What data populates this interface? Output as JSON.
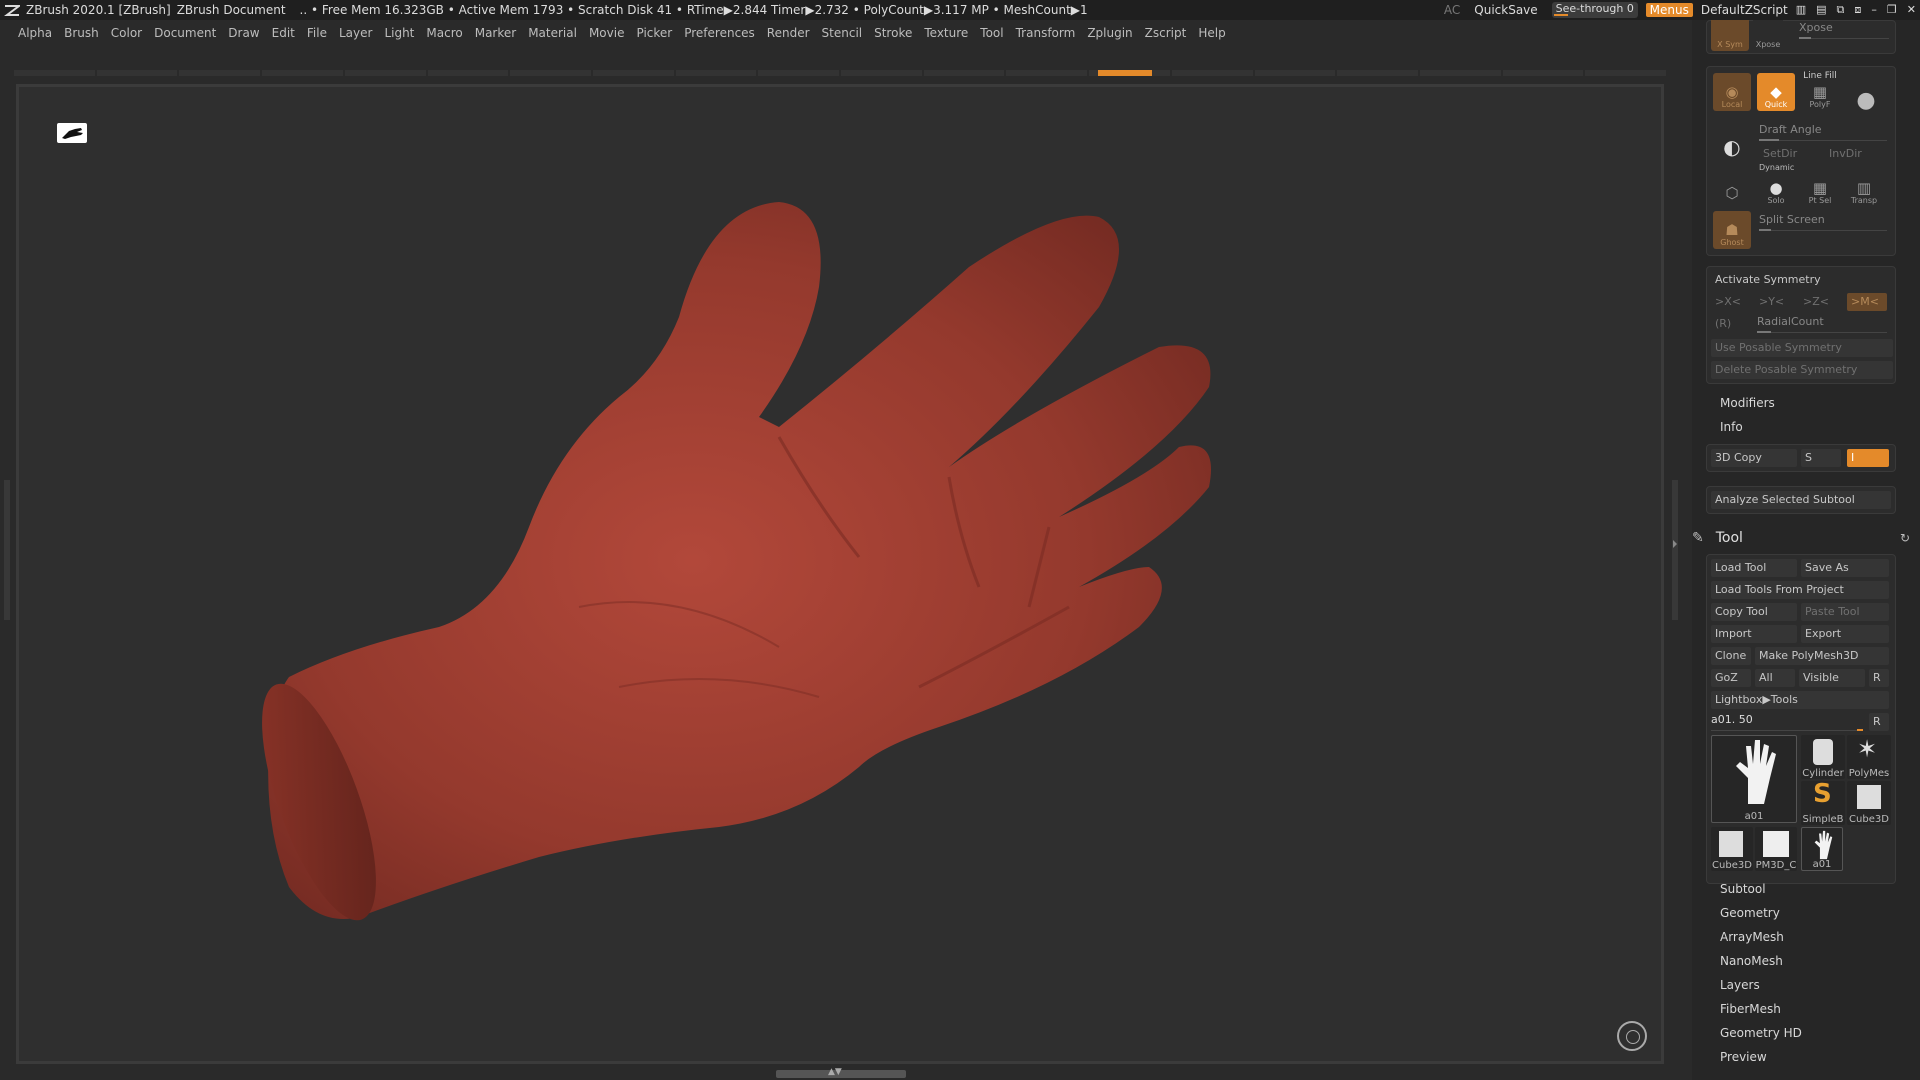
{
  "title_bar": {
    "app": "ZBrush 2020.1 [ZBrush]",
    "document": "ZBrush Document",
    "stats": ".. • Free Mem 16.323GB • Active Mem 1793 • Scratch Disk 41 • RTime▶2.844 Timer▶2.732 • PolyCount▶3.117 MP • MeshCount▶1",
    "ac": "AC",
    "quicksave": "QuickSave",
    "see_through": "See-through  0",
    "menus": "Menus",
    "script": "DefaultZScript"
  },
  "menu": [
    "Alpha",
    "Brush",
    "Color",
    "Document",
    "Draw",
    "Edit",
    "File",
    "Layer",
    "Light",
    "Macro",
    "Marker",
    "Material",
    "Movie",
    "Picker",
    "Preferences",
    "Render",
    "Stencil",
    "Stroke",
    "Texture",
    "Tool",
    "Transform",
    "Zplugin",
    "Zscript",
    "Help"
  ],
  "top_shelf": {
    "xsym": "X Sym",
    "xpose": "Xpose",
    "xpose_label": "Xpose"
  },
  "draw_group": {
    "local": "Local",
    "quick": "Quick",
    "polyf": "PolyF",
    "linefill": "Line Fill",
    "draft_angle": "Draft Angle",
    "setdir": "SetDir",
    "invdir": "InvDir",
    "dynamic": "Dynamic",
    "solo": "Solo",
    "ptsel": "Pt Sel",
    "transp": "Transp",
    "ghost": "Ghost",
    "split_screen": "Split Screen"
  },
  "symmetry": {
    "activate": "Activate Symmetry",
    "x": ">X<",
    "y": ">Y<",
    "z": ">Z<",
    "m": ">M<",
    "r": "(R)",
    "radial": "RadialCount",
    "use_posable": "Use Posable Symmetry",
    "delete_posable": "Delete Posable Symmetry"
  },
  "sections1": {
    "modifiers": "Modifiers",
    "info": "Info"
  },
  "copy3d": {
    "label": "3D Copy",
    "s": "S",
    "i": "I"
  },
  "analyze": "Analyze Selected Subtool",
  "tool": {
    "title": "Tool",
    "load": "Load Tool",
    "save_as": "Save As",
    "load_project": "Load Tools From Project",
    "copy": "Copy Tool",
    "paste": "Paste Tool",
    "import": "Import",
    "export": "Export",
    "clone": "Clone",
    "make_poly": "Make PolyMesh3D",
    "goz": "GoZ",
    "all": "All",
    "visible": "Visible",
    "r": "R",
    "lightbox": "Lightbox▶Tools",
    "current": "a01. 50",
    "current_r": "R",
    "thumbs": [
      {
        "name": "a01"
      },
      {
        "name": "Cylinder"
      },
      {
        "name": "PolyMes"
      },
      {
        "name": "SimpleB"
      },
      {
        "name": "Cube3D"
      },
      {
        "name": "Cube3D"
      },
      {
        "name": "PM3D_C"
      },
      {
        "name": "a01"
      }
    ]
  },
  "sections2": [
    "Subtool",
    "Geometry",
    "ArrayMesh",
    "NanoMesh",
    "Layers",
    "FiberMesh",
    "Geometry HD",
    "Preview"
  ],
  "colors": {
    "accent": "#e48a2a",
    "mesh": "#9a3a2e",
    "bg": "#2f2f2f"
  }
}
